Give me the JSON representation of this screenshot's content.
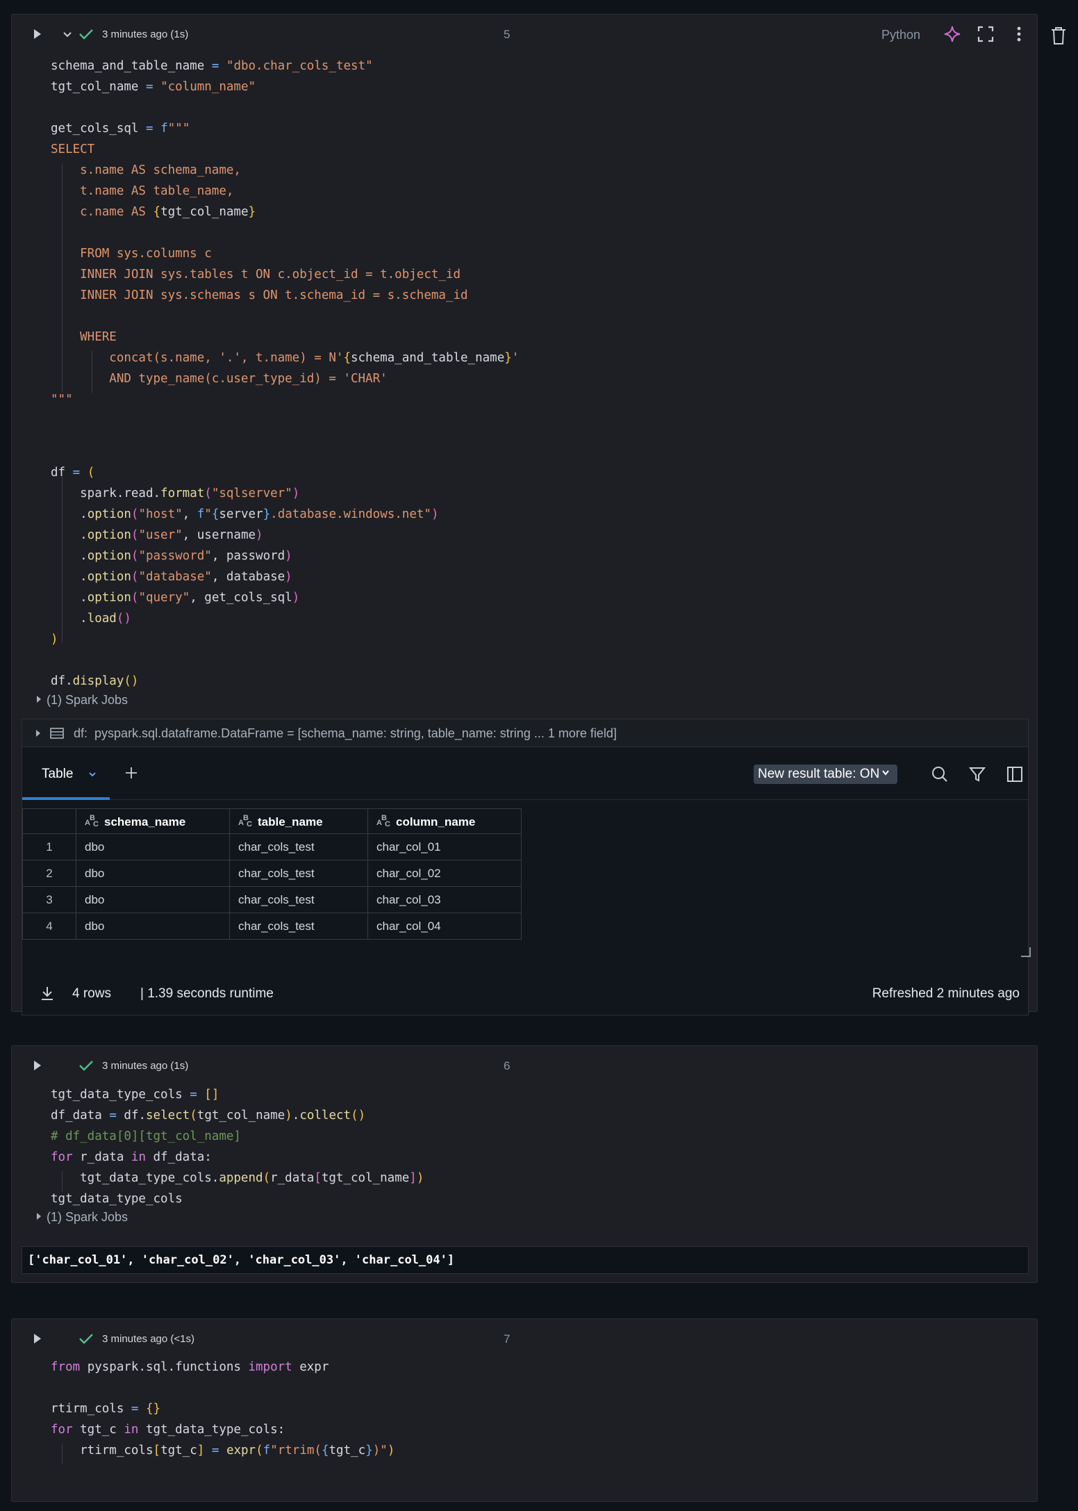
{
  "cells": [
    {
      "status": "3 minutes ago (1s)",
      "number": "5",
      "language": "Python",
      "spark_jobs": "(1) Spark Jobs",
      "result": {
        "df_label": "df:",
        "df_type": "pyspark.sql.dataframe.DataFrame = [schema_name: string, table_name: string ... 1 more field]",
        "tab_label": "Table",
        "new_result_table": "New result table: ON",
        "columns": [
          "schema_name",
          "table_name",
          "column_name"
        ],
        "rows": [
          [
            "1",
            "dbo",
            "char_cols_test",
            "char_col_01"
          ],
          [
            "2",
            "dbo",
            "char_cols_test",
            "char_col_02"
          ],
          [
            "3",
            "dbo",
            "char_cols_test",
            "char_col_03"
          ],
          [
            "4",
            "dbo",
            "char_cols_test",
            "char_col_04"
          ]
        ],
        "rows_count": "4 rows",
        "runtime": "|  1.39 seconds runtime",
        "refreshed": "Refreshed 2 minutes ago"
      }
    },
    {
      "status": "3 minutes ago (1s)",
      "number": "6",
      "spark_jobs": "(1) Spark Jobs",
      "output": "['char_col_01', 'char_col_02', 'char_col_03', 'char_col_04']"
    },
    {
      "status": "3 minutes ago (<1s)",
      "number": "7"
    }
  ],
  "colors": {
    "background": "#0e1319",
    "cell_background": "#1d1f24",
    "success_check": "#4fbf8a",
    "assistant_icon": "#d16ad6",
    "tab_underline": "#2d7fd5"
  },
  "icons": [
    "run-icon",
    "chevron-down-icon",
    "check-icon",
    "assistant-sparkle-icon",
    "fullscreen-icon",
    "more-vertical-icon",
    "trash-icon",
    "table-icon",
    "plus-icon",
    "search-icon",
    "filter-icon",
    "sidebar-panel-icon",
    "download-icon",
    "string-type-icon"
  ]
}
